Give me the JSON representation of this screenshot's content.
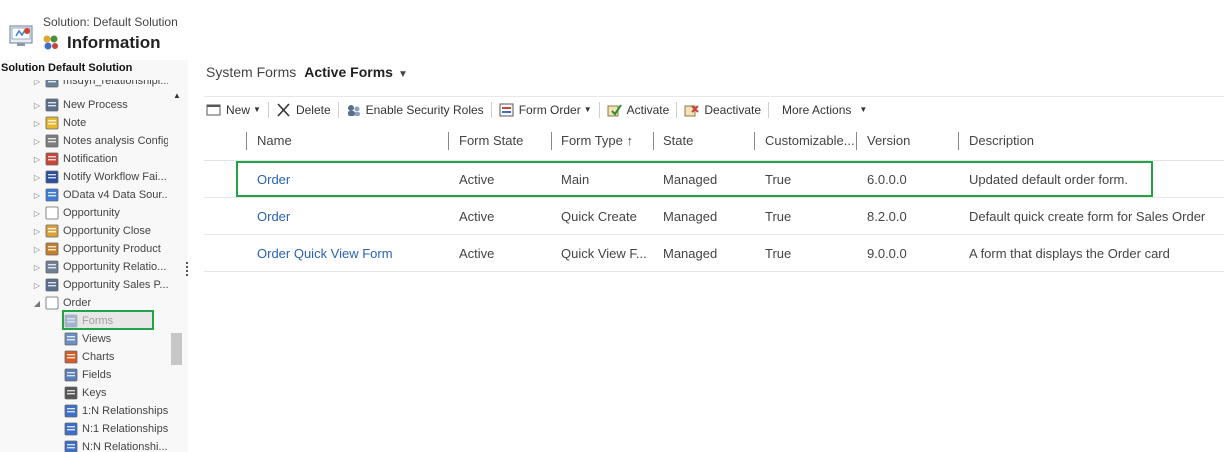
{
  "header": {
    "solution_title": "Solution: Default Solution",
    "section_title": "Information",
    "solution_label": "Solution Default Solution"
  },
  "tree": {
    "items": [
      {
        "label": "msdyn_relationshipi...",
        "icon": "relationship-icon",
        "arrow": "▷"
      },
      {
        "label": "New Process",
        "icon": "process-icon",
        "arrow": "▷"
      },
      {
        "label": "Note",
        "icon": "note-icon",
        "arrow": "▷"
      },
      {
        "label": "Notes analysis Config",
        "icon": "config-icon",
        "arrow": "▷"
      },
      {
        "label": "Notification",
        "icon": "notification-icon",
        "arrow": "▷"
      },
      {
        "label": "Notify Workflow Fai...",
        "icon": "workflow-fail-icon",
        "arrow": "▷"
      },
      {
        "label": "OData v4 Data Sour...",
        "icon": "data-source-icon",
        "arrow": "▷"
      },
      {
        "label": "Opportunity",
        "icon": "opportunity-icon",
        "arrow": "▷"
      },
      {
        "label": "Opportunity Close",
        "icon": "opportunity-close-icon",
        "arrow": "▷"
      },
      {
        "label": "Opportunity Product",
        "icon": "opportunity-product-icon",
        "arrow": "▷"
      },
      {
        "label": "Opportunity Relatio...",
        "icon": "opportunity-relationship-icon",
        "arrow": "▷"
      },
      {
        "label": "Opportunity Sales P...",
        "icon": "sales-process-icon",
        "arrow": "▷"
      },
      {
        "label": "Order",
        "icon": "order-icon",
        "arrow": "◢"
      }
    ],
    "order_children": [
      {
        "label": "Forms",
        "icon": "forms-icon"
      },
      {
        "label": "Views",
        "icon": "views-icon"
      },
      {
        "label": "Charts",
        "icon": "charts-icon"
      },
      {
        "label": "Fields",
        "icon": "fields-icon"
      },
      {
        "label": "Keys",
        "icon": "keys-icon"
      },
      {
        "label": "1:N Relationships",
        "icon": "relationship-1n-icon"
      },
      {
        "label": "N:1 Relationships",
        "icon": "relationship-n1-icon"
      },
      {
        "label": "N:N Relationshi...",
        "icon": "relationship-nn-icon"
      }
    ]
  },
  "view": {
    "prefix": "System Forms",
    "name": "Active Forms",
    "chevron": "⌄"
  },
  "toolbar": {
    "new_label": "New",
    "delete_label": "Delete",
    "security_label": "Enable Security Roles",
    "form_order_label": "Form Order",
    "activate_label": "Activate",
    "deactivate_label": "Deactivate",
    "more_label": "More Actions"
  },
  "grid": {
    "columns": [
      "Name",
      "Form State",
      "Form Type ↑",
      "State",
      "Customizable...",
      "Version",
      "Description"
    ],
    "rows": [
      [
        "Order",
        "Active",
        "Main",
        "Managed",
        "True",
        "6.0.0.0",
        "Updated default order form."
      ],
      [
        "Order",
        "Active",
        "Quick Create",
        "Managed",
        "True",
        "8.2.0.0",
        "Default quick create form for Sales Order"
      ],
      [
        "Order Quick View Form",
        "Active",
        "Quick View F...",
        "Managed",
        "True",
        "9.0.0.0",
        "A form that displays the Order card"
      ]
    ]
  },
  "colors": {
    "link": "#2a62b3",
    "highlight": "#22a34a"
  }
}
